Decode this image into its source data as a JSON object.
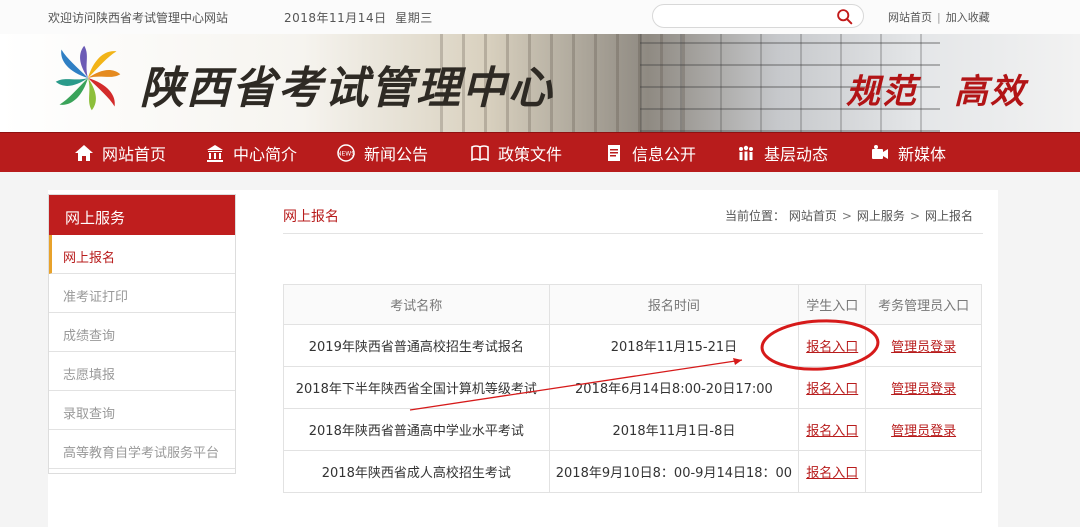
{
  "topbar": {
    "welcome": "欢迎访问陕西省考试管理中心网站",
    "date": "2018年11月14日",
    "weekday": "星期三",
    "search_placeholder": "",
    "links": [
      "网站首页",
      "加入收藏"
    ]
  },
  "banner": {
    "site_title": "陕西省考试管理中心",
    "slogan": "规范　高效"
  },
  "nav": {
    "items": [
      {
        "label": "网站首页",
        "icon": "home-icon"
      },
      {
        "label": "中心简介",
        "icon": "building-icon"
      },
      {
        "label": "新闻公告",
        "icon": "news-icon"
      },
      {
        "label": "政策文件",
        "icon": "book-icon"
      },
      {
        "label": "信息公开",
        "icon": "document-icon"
      },
      {
        "label": "基层动态",
        "icon": "people-icon"
      },
      {
        "label": "新媒体",
        "icon": "media-icon"
      }
    ]
  },
  "sidebar": {
    "title": "网上服务",
    "items": [
      {
        "label": "网上报名",
        "active": true
      },
      {
        "label": "准考证打印"
      },
      {
        "label": "成绩查询"
      },
      {
        "label": "志愿填报"
      },
      {
        "label": "录取查询"
      },
      {
        "label": "高等教育自学考试服务平台"
      }
    ]
  },
  "content": {
    "title": "网上报名",
    "breadcrumb": {
      "prefix": "当前位置：",
      "items": [
        "网站首页",
        "网上服务",
        "网上报名"
      ],
      "separator": ">"
    }
  },
  "table": {
    "headers": [
      "考试名称",
      "报名时间",
      "学生入口",
      "考务管理员入口"
    ],
    "rows": [
      {
        "name": "2019年陕西省普通高校招生考试报名",
        "time": "2018年11月15-21日",
        "student": "报名入口",
        "admin": "管理员登录"
      },
      {
        "name": "2018年下半年陕西省全国计算机等级考试",
        "time": "2018年6月14日8:00-20日17:00",
        "student": "报名入口",
        "admin": "管理员登录"
      },
      {
        "name": "2018年陕西省普通高中学业水平考试",
        "time": "2018年11月1日-8日",
        "student": "报名入口",
        "admin": "管理员登录"
      },
      {
        "name": "2018年陕西省成人高校招生考试",
        "time": "2018年9月10日8：00-9月14日18：00",
        "student": "报名入口",
        "admin": ""
      }
    ]
  },
  "colors": {
    "brand_red": "#b81c1c",
    "sidebar_accent": "#e8a22b",
    "annotation_red": "#d61a1a"
  }
}
